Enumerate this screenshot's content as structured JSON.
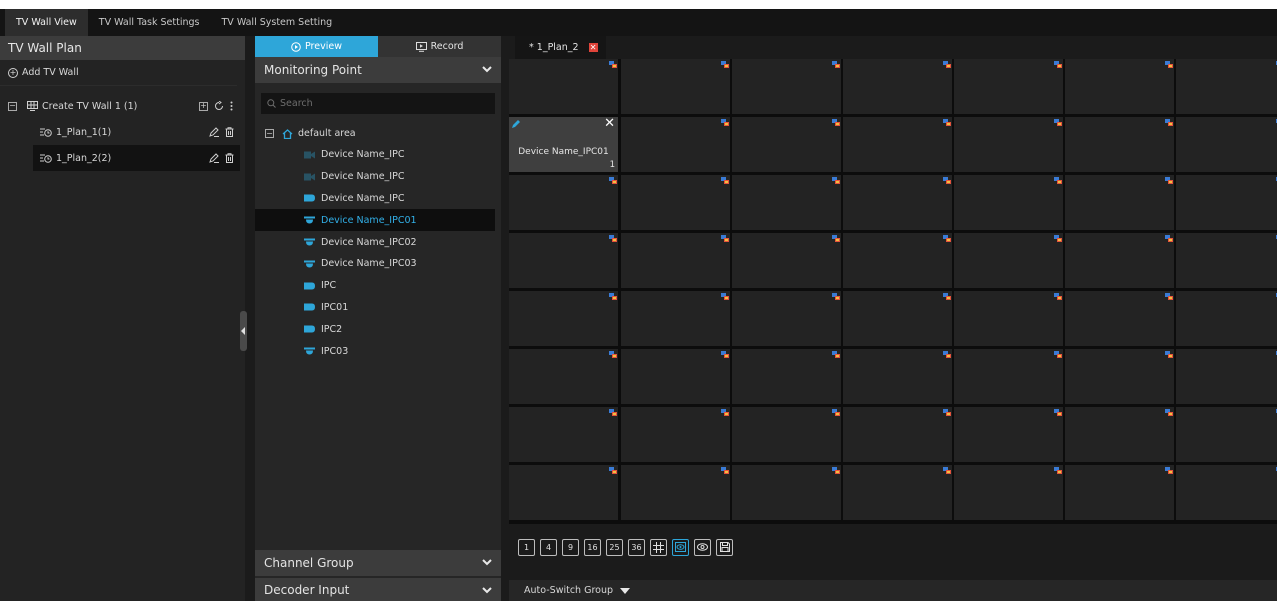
{
  "top_tabs": [
    {
      "label": "TV Wall View"
    },
    {
      "label": "TV Wall Task Settings"
    },
    {
      "label": "TV Wall System Setting"
    }
  ],
  "left_panel": {
    "title": "TV Wall Plan",
    "add_wall_label": "Add TV Wall",
    "wall": {
      "label": "Create TV Wall 1 (1)"
    },
    "plans": [
      {
        "label": "1_Plan_1(1)"
      },
      {
        "label": "1_Plan_2(2)"
      }
    ]
  },
  "middle_panel": {
    "tabs": [
      {
        "label": "Preview"
      },
      {
        "label": "Record"
      }
    ],
    "monitoring_title": "Monitoring Point",
    "search_placeholder": "Search",
    "root_label": "default area",
    "devices": [
      {
        "label": "Device Name_IPC",
        "icon": "camera-offline-icon"
      },
      {
        "label": "Device Name_IPC",
        "icon": "camera-offline-icon"
      },
      {
        "label": "Device Name_IPC",
        "icon": "bullet-camera-icon"
      },
      {
        "label": "Device Name_IPC01",
        "icon": "dome-camera-icon"
      },
      {
        "label": "Device Name_IPC02",
        "icon": "dome-camera-icon"
      },
      {
        "label": "Device Name_IPC03",
        "icon": "dome-camera-icon"
      },
      {
        "label": "IPC",
        "icon": "bullet-camera-icon"
      },
      {
        "label": "IPC01",
        "icon": "bullet-camera-icon"
      },
      {
        "label": "IPC2",
        "icon": "bullet-camera-icon"
      },
      {
        "label": "IPC03",
        "icon": "dome-camera-icon"
      }
    ],
    "channel_group_title": "Channel Group",
    "decoder_input_title": "Decoder Input"
  },
  "right_panel": {
    "plan_tab_label": "* 1_Plan_2",
    "active_cell": {
      "label": "Device Name_IPC01",
      "number": "1"
    },
    "layout_buttons": [
      "1",
      "4",
      "9",
      "16",
      "25",
      "36"
    ],
    "auto_switch_label": "Auto-Switch Group"
  },
  "colors": {
    "accent": "#2ea6d9",
    "close_red": "#e0443a",
    "selected_text": "#32b0e8"
  }
}
